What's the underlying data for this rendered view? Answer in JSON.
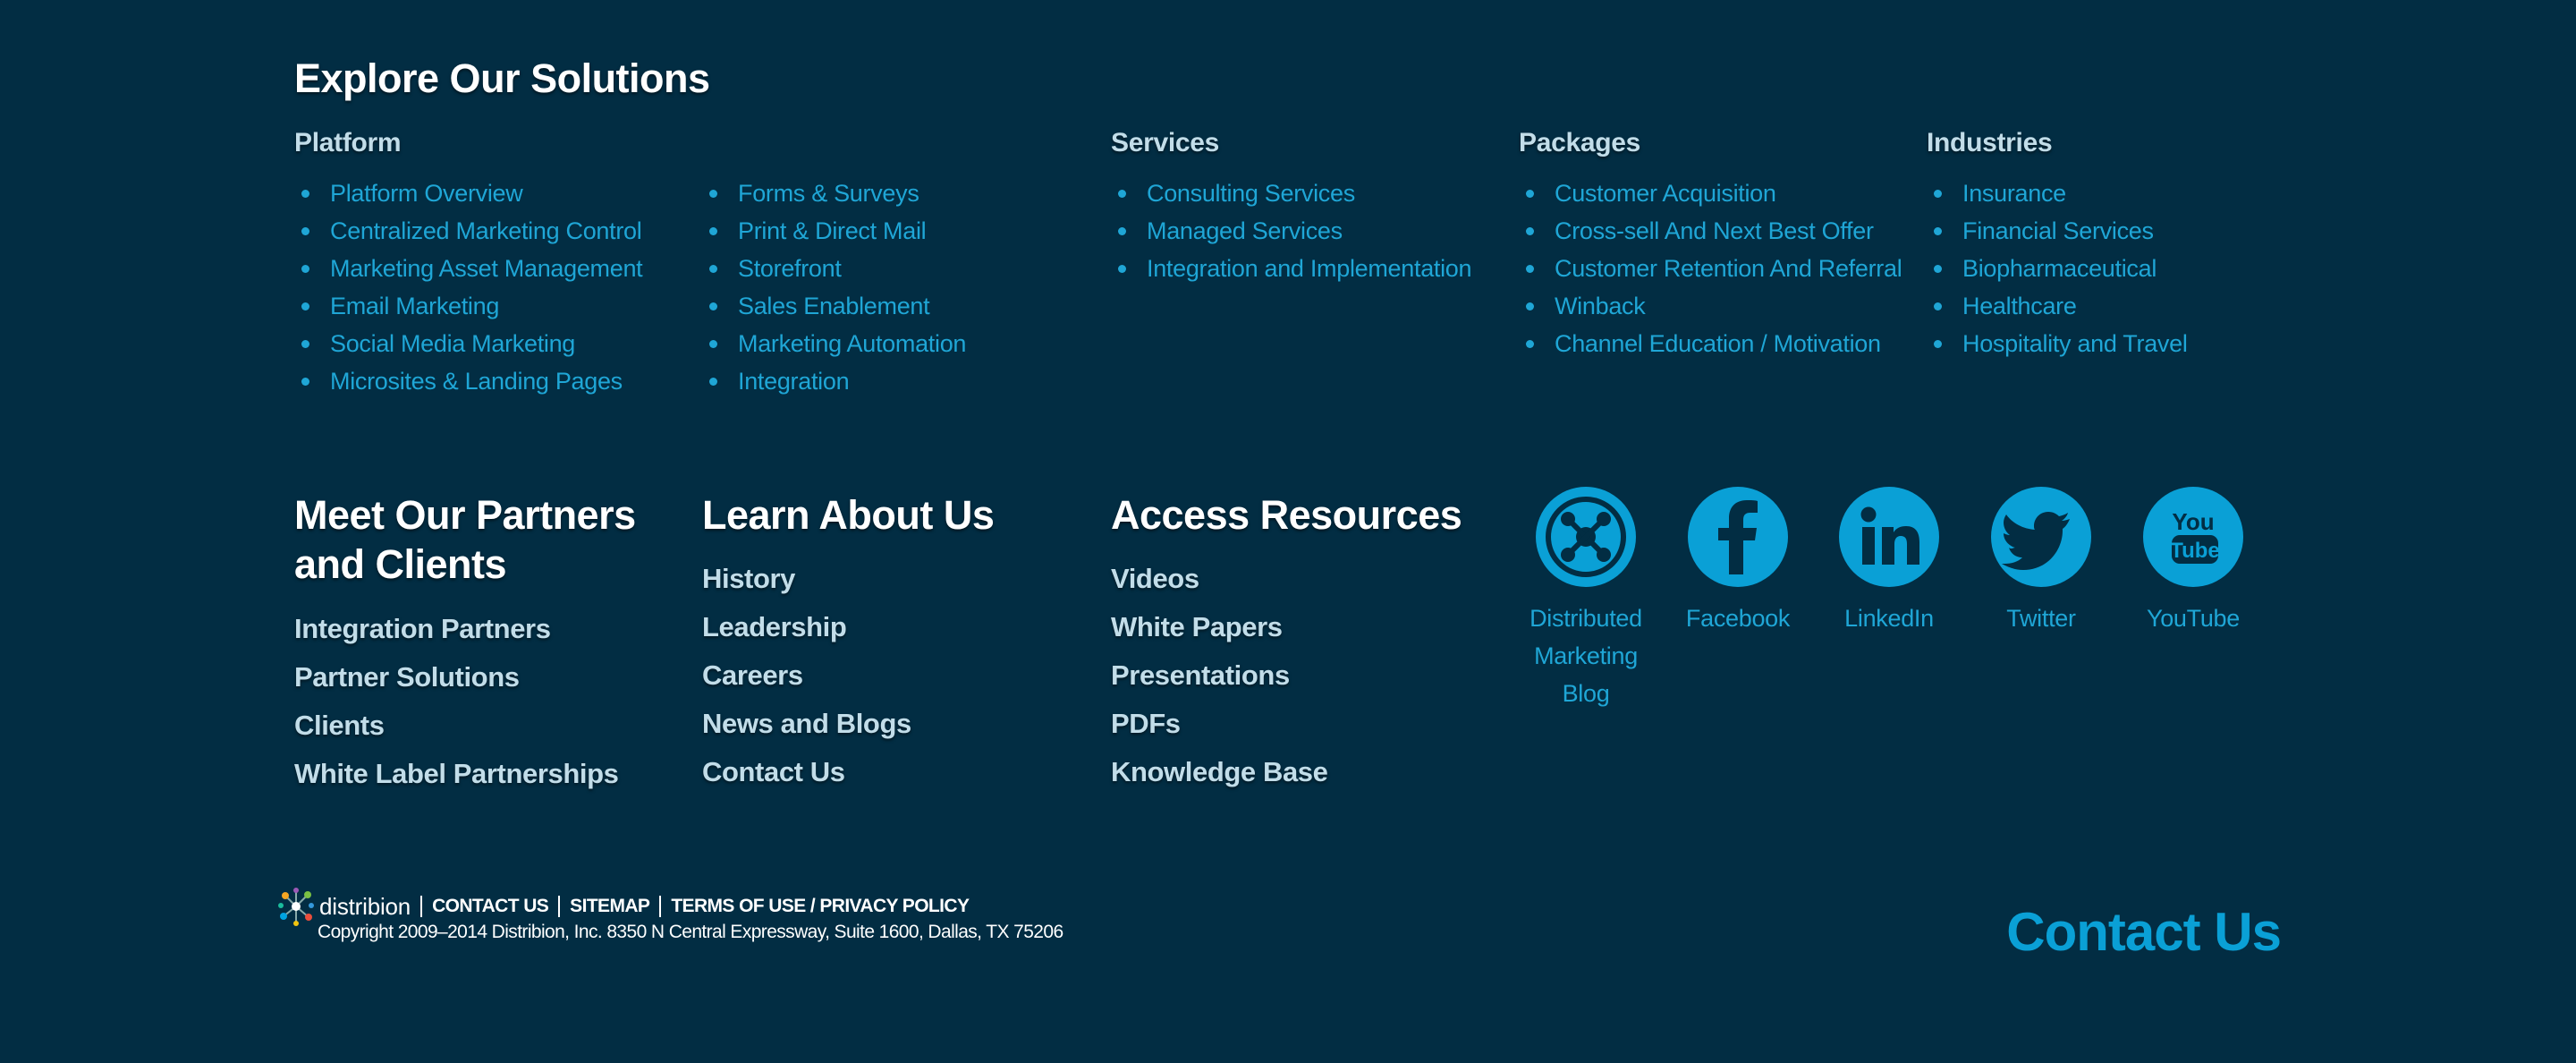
{
  "solutions": {
    "heading": "Explore Our Solutions",
    "platform": {
      "title": "Platform",
      "col1": [
        "Platform Overview",
        "Centralized Marketing Control",
        "Marketing Asset Management",
        "Email Marketing",
        "Social Media Marketing",
        "Microsites & Landing Pages"
      ],
      "col2": [
        "Forms & Surveys",
        "Print & Direct Mail",
        "Storefront",
        "Sales Enablement",
        "Marketing Automation",
        "Integration"
      ]
    },
    "services": {
      "title": "Services",
      "items": [
        "Consulting Services",
        "Managed Services",
        "Integration and Implementation"
      ]
    },
    "packages": {
      "title": "Packages",
      "items": [
        "Customer Acquisition",
        "Cross-sell And Next Best Offer",
        "Customer Retention And Referral",
        "Winback",
        "Channel Education / Motivation"
      ]
    },
    "industries": {
      "title": "Industries",
      "items": [
        "Insurance",
        "Financial Services",
        "Biopharmaceutical",
        "Healthcare",
        "Hospitality and Travel"
      ]
    }
  },
  "partners": {
    "heading_line1": "Meet Our Partners",
    "heading_line2": "and Clients",
    "items": [
      "Integration Partners",
      "Partner Solutions",
      "Clients",
      "White Label Partnerships"
    ]
  },
  "about": {
    "heading": "Learn About Us",
    "items": [
      "History",
      "Leadership",
      "Careers",
      "News and Blogs",
      "Contact Us"
    ]
  },
  "resources": {
    "heading": "Access Resources",
    "items": [
      "Videos",
      "White Papers",
      "Presentations",
      "PDFs",
      "Knowledge Base"
    ]
  },
  "social": {
    "blog": {
      "line1": "Distributed",
      "line2": "Marketing",
      "line3": "Blog",
      "icon": "distributed-marketing-blog-icon"
    },
    "facebook": {
      "label": "Facebook",
      "icon": "facebook-icon"
    },
    "linkedin": {
      "label": "LinkedIn",
      "icon": "linkedin-icon"
    },
    "twitter": {
      "label": "Twitter",
      "icon": "twitter-icon"
    },
    "youtube": {
      "label": "YouTube",
      "icon": "youtube-icon",
      "logo_line1": "You",
      "logo_line2": "Tube"
    }
  },
  "footer": {
    "brand": "distribion",
    "nav": [
      "CONTACT US",
      "SITEMAP",
      "TERMS OF USE / PRIVACY POLICY"
    ],
    "copyright": "Copyright 2009–2014 Distribion, Inc. 8350 N Central Expressway, Suite 1600, Dallas, TX 75206",
    "contact_cta": "Contact Us"
  },
  "colors": {
    "background": "#022d43",
    "link": "#1fa6d6",
    "accent": "#0aa0d6",
    "heading": "#ffffff",
    "subheading": "#c2dde9"
  }
}
